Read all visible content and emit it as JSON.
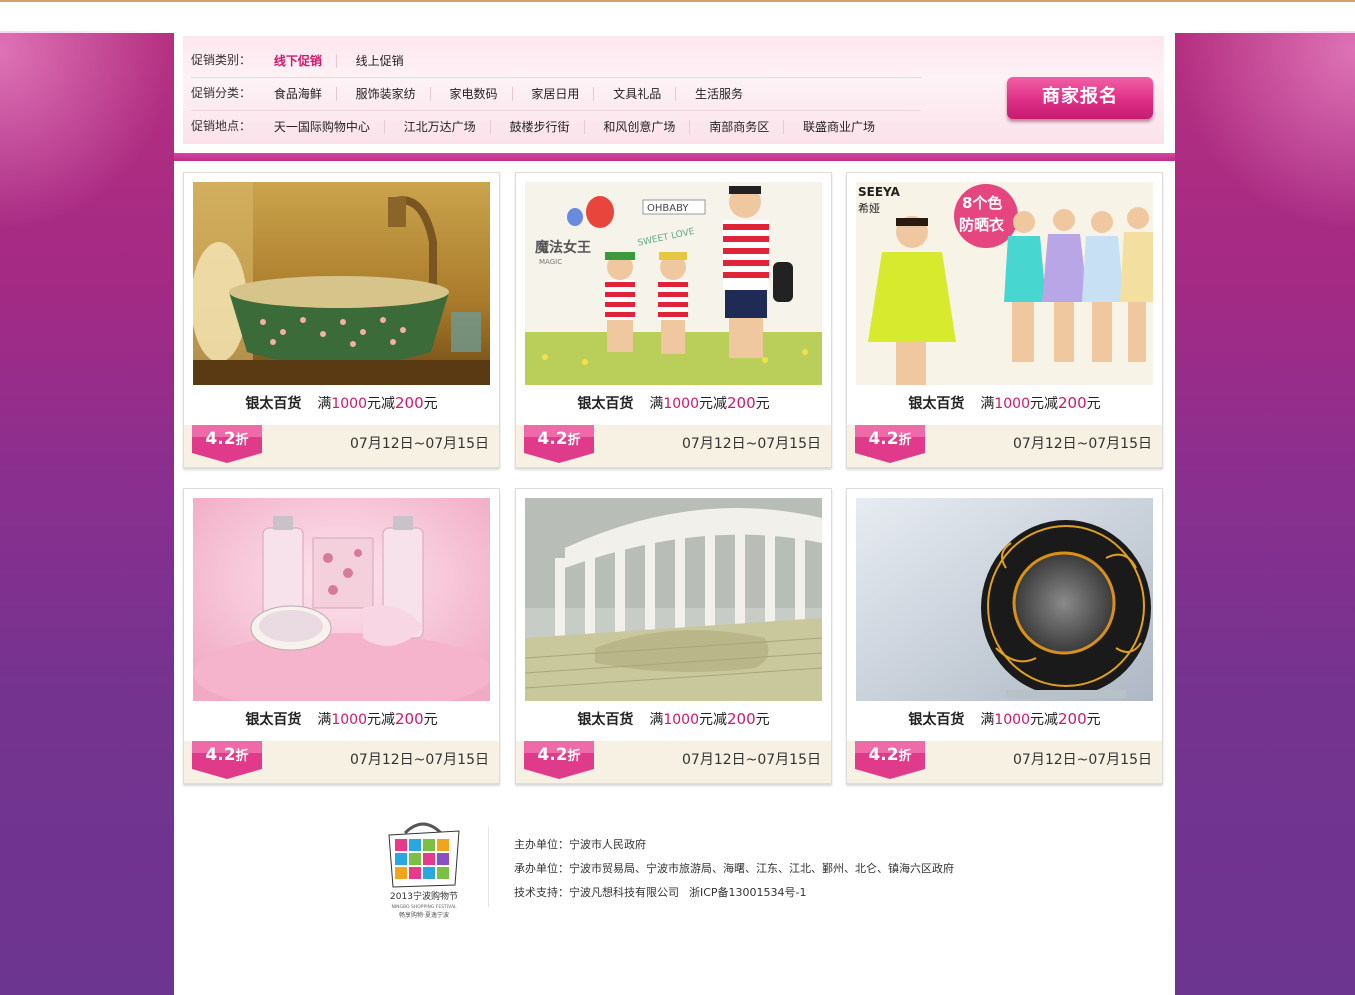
{
  "filter": {
    "type_label": "促销类别：",
    "types": [
      {
        "label": "线下促销",
        "active": true
      },
      {
        "label": "线上促销",
        "active": false
      }
    ],
    "category_label": "促销分类：",
    "categories": [
      "食品海鲜",
      "服饰装家纺",
      "家电数码",
      "家居日用",
      "文具礼品",
      "生活服务"
    ],
    "location_label": "促销地点：",
    "locations": [
      "天一国际购物中心",
      "江北万达广场",
      "鼓楼步行街",
      "和风创意广场",
      "南部商务区",
      "联盛商业广场"
    ],
    "register_button": "商家报名"
  },
  "products": [
    {
      "store": "银太百货",
      "prefix": "满",
      "threshold": "1000",
      "mid": "元减",
      "discount_amount": "200",
      "suffix": "元",
      "discount_main": "4.2",
      "discount_unit": "折",
      "dates": "07月12日~07月15日",
      "image_icon": "washbasin-photo-icon"
    },
    {
      "store": "银太百货",
      "prefix": "满",
      "threshold": "1000",
      "mid": "元减",
      "discount_amount": "200",
      "suffix": "元",
      "discount_main": "4.2",
      "discount_unit": "折",
      "dates": "07月12日~07月15日",
      "image_icon": "family-clothing-photo-icon",
      "image_text": [
        "魔法女王",
        "MAGIC",
        "OHBABY",
        "SWEET LOVE"
      ]
    },
    {
      "store": "银太百货",
      "prefix": "满",
      "threshold": "1000",
      "mid": "元减",
      "discount_amount": "200",
      "suffix": "元",
      "discount_main": "4.2",
      "discount_unit": "折",
      "dates": "07月12日~07月15日",
      "image_icon": "sun-protection-clothing-photo-icon",
      "image_text": [
        "SEEYA",
        "希娅",
        "8个色",
        "防晒衣"
      ]
    },
    {
      "store": "银太百货",
      "prefix": "满",
      "threshold": "1000",
      "mid": "元减",
      "discount_amount": "200",
      "suffix": "元",
      "discount_main": "4.2",
      "discount_unit": "折",
      "dates": "07月12日~07月15日",
      "image_icon": "cosmetics-gift-set-photo-icon"
    },
    {
      "store": "银太百货",
      "prefix": "满",
      "threshold": "1000",
      "mid": "元减",
      "discount_amount": "200",
      "suffix": "元",
      "discount_main": "4.2",
      "discount_unit": "折",
      "dates": "07月12日~07月15日",
      "image_icon": "baby-crib-photo-icon"
    },
    {
      "store": "银太百货",
      "prefix": "满",
      "threshold": "1000",
      "mid": "元减",
      "discount_amount": "200",
      "suffix": "元",
      "discount_main": "4.2",
      "discount_unit": "折",
      "dates": "07月12日~07月15日",
      "image_icon": "speaker-photo-icon"
    }
  ],
  "footer": {
    "logo_year": "2013宁波购物节",
    "logo_en": "NINGBO SHOPPING FESTIVAL",
    "logo_slogan": "畅享购物·夏逸宁波",
    "organizer": "主办单位：宁波市人民政府",
    "co_organizer": "承办单位：宁波市贸易局、宁波市旅游局、海曙、江东、江北、鄞州、北仑、镇海六区政府",
    "tech_support": "技术支持：宁波凡想科技有限公司",
    "icp": "浙ICP备13001534号-1"
  },
  "colors": {
    "accent": "#d1176d",
    "background_top": "#b8307f",
    "background_bottom": "#6c3590",
    "card_footer": "#f6f1e2"
  }
}
